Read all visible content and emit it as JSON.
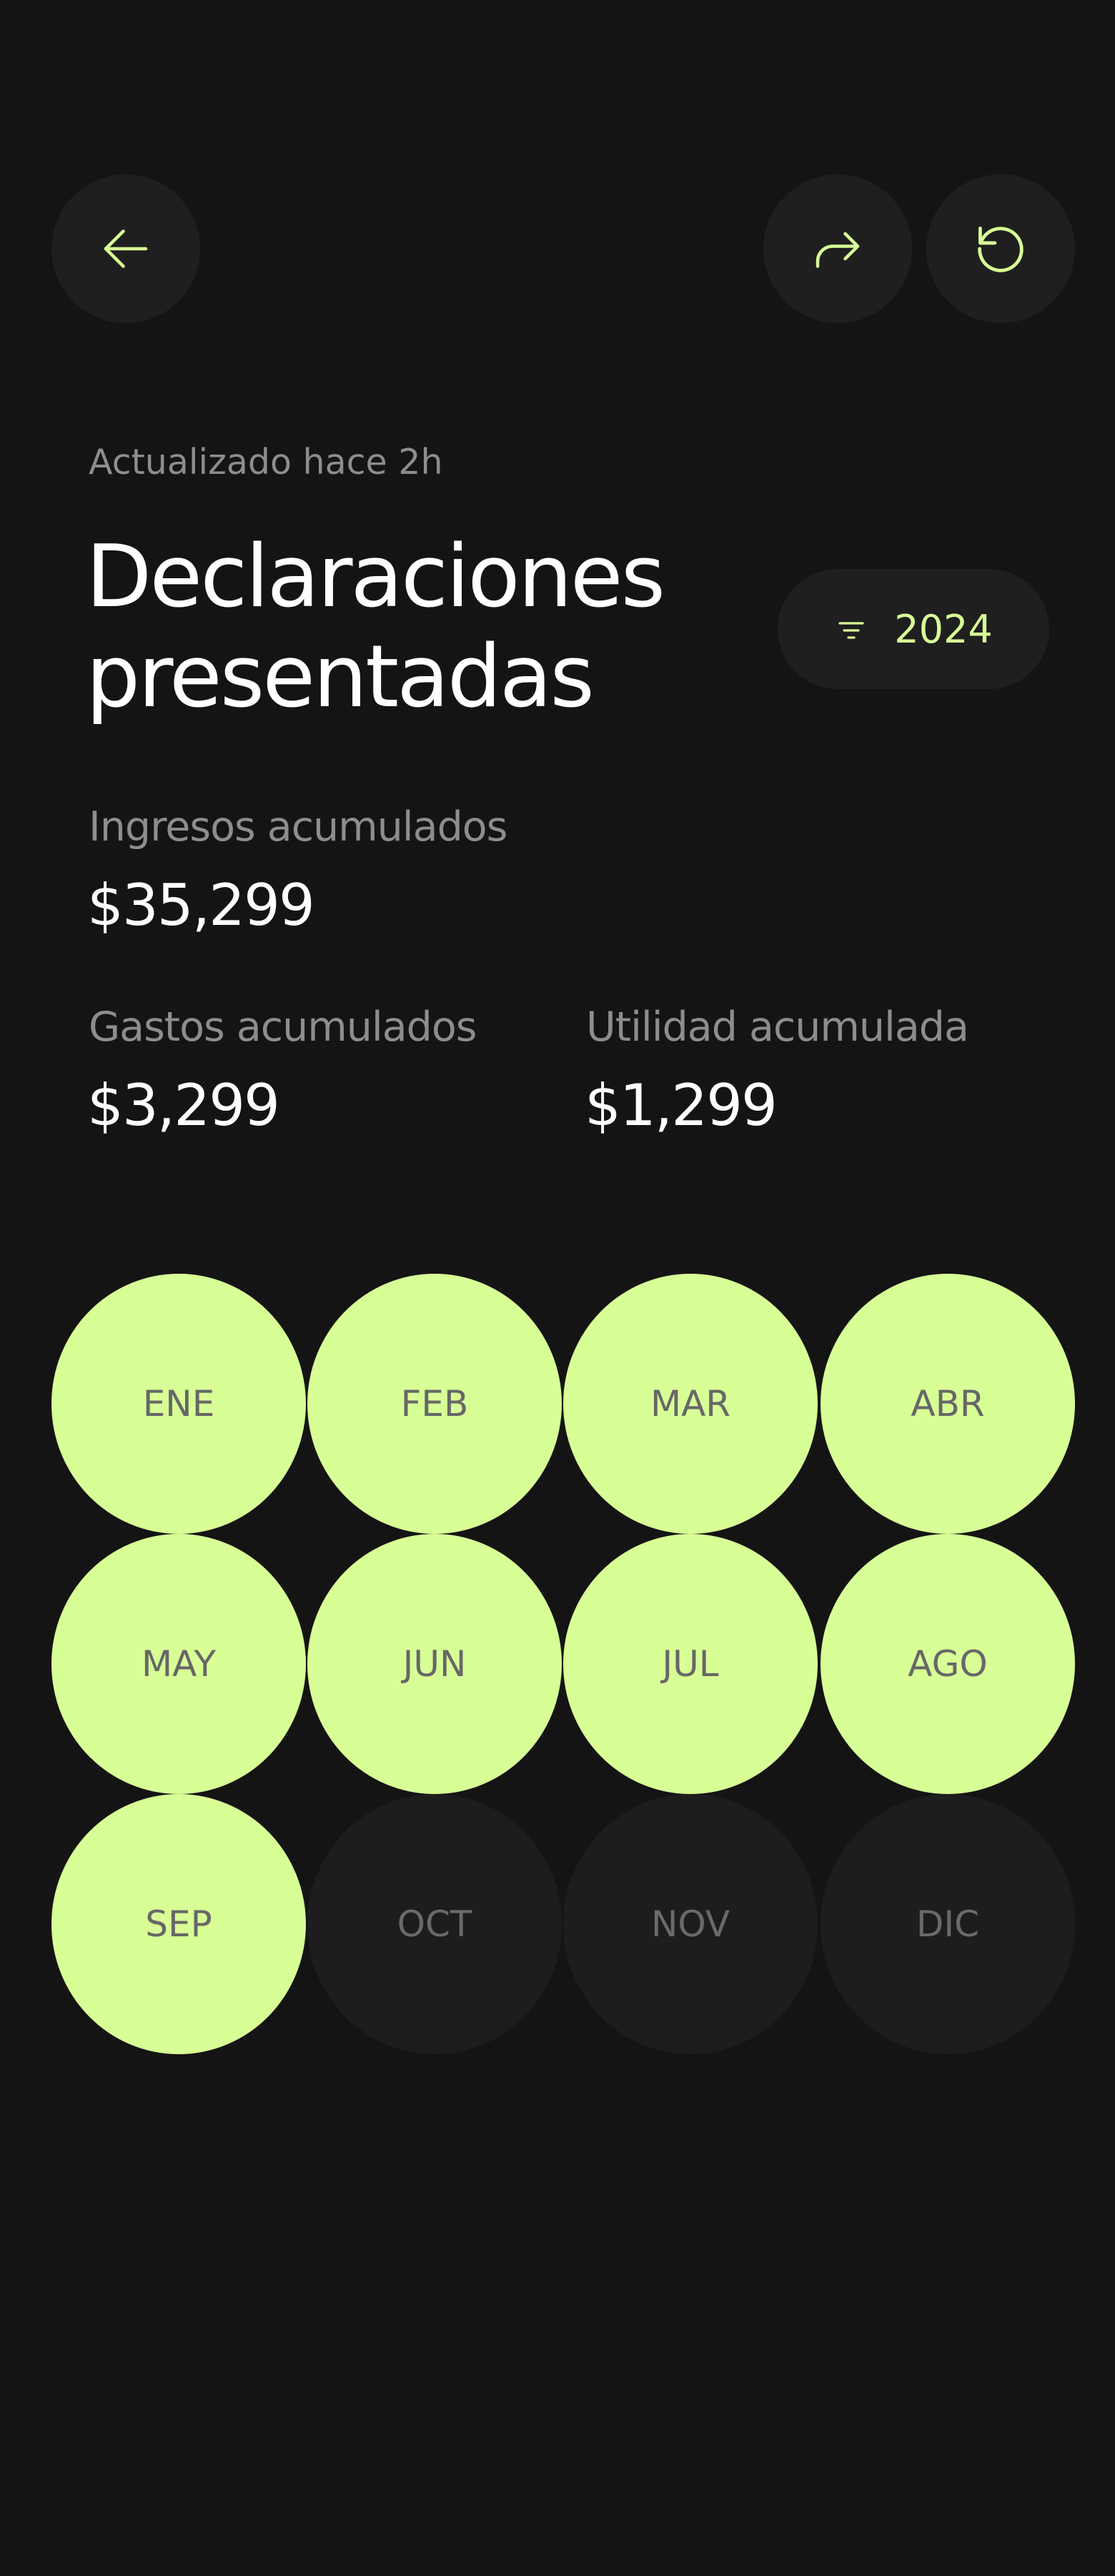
{
  "header": {
    "back_icon": "arrow-left-icon",
    "share_icon": "share-forward-icon",
    "refresh_icon": "refresh-icon",
    "accent_color": "#d8fe96"
  },
  "updated_text": "Actualizado hace 2h",
  "title_line1": "Declaraciones",
  "title_line2": "presentadas",
  "year_filter": {
    "icon": "filter-icon",
    "label": "2024"
  },
  "stats": {
    "income_label": "Ingresos acumulados",
    "income_value": "$35,299",
    "expenses_label": "Gastos acumulados",
    "expenses_value": "$3,299",
    "profit_label": "Utilidad acumulada",
    "profit_value": "$1,299"
  },
  "months": [
    {
      "label": "ENE",
      "status": "filed"
    },
    {
      "label": "FEB",
      "status": "filed"
    },
    {
      "label": "MAR",
      "status": "filed"
    },
    {
      "label": "ABR",
      "status": "filed"
    },
    {
      "label": "MAY",
      "status": "filed"
    },
    {
      "label": "JUN",
      "status": "filed"
    },
    {
      "label": "JUL",
      "status": "filed"
    },
    {
      "label": "AGO",
      "status": "filed"
    },
    {
      "label": "SEP",
      "status": "filed"
    },
    {
      "label": "OCT",
      "status": "pending"
    },
    {
      "label": "NOV",
      "status": "pending"
    },
    {
      "label": "DIC",
      "status": "pending"
    }
  ],
  "colors": {
    "background": "#141414",
    "button_bg": "#1f1f1f",
    "filed": "#d8fe96",
    "pending": "#1d1d1d",
    "muted_text": "#8d8d8d"
  }
}
